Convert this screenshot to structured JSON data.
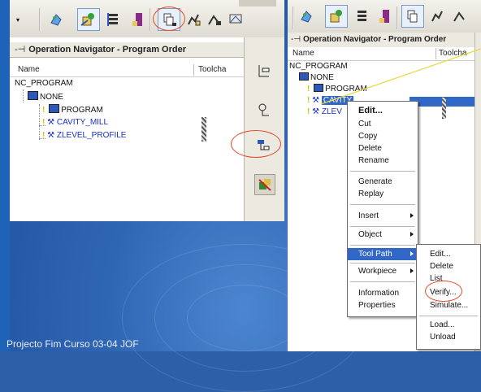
{
  "left_panel": {
    "navigator_title": "Operation Navigator - Program Order",
    "columns": [
      "Name",
      "Toolcha"
    ],
    "tree": [
      {
        "label": "NC_PROGRAM",
        "blue": false
      },
      {
        "label": "NONE",
        "blue": false
      },
      {
        "label": "PROGRAM",
        "blue": false
      },
      {
        "label": "CAVITY_MILL",
        "blue": true
      },
      {
        "label": "ZLEVEL_PROFILE",
        "blue": true
      }
    ]
  },
  "right_panel": {
    "navigator_title": "Operation Navigator - Program Order",
    "columns": [
      "Name",
      "Toolcha"
    ],
    "tree": [
      {
        "label": "NC_PROGRAM"
      },
      {
        "label": "NONE"
      },
      {
        "label": "PROGRAM"
      },
      {
        "label": "CAVITY"
      },
      {
        "label": "ZLEV"
      }
    ]
  },
  "context_menu": {
    "items": [
      "Edit...",
      "Cut",
      "Copy",
      "Delete",
      "Rename",
      "Generate",
      "Replay",
      "Insert",
      "Object",
      "Tool Path",
      "Workpiece",
      "Information",
      "Properties"
    ],
    "selected": "Tool Path"
  },
  "submenu": {
    "items": [
      "Edit...",
      "Delete",
      "List",
      "Verify...",
      "Simulate...",
      "Load...",
      "Unload"
    ],
    "highlighted": "Verify..."
  },
  "footer": "Projecto Fim Curso 03-04 JOF",
  "colors": {
    "selection": "#3168c8",
    "highlight_ellipse": "#e04a2a",
    "tree_blue": "#1a2ec8"
  }
}
